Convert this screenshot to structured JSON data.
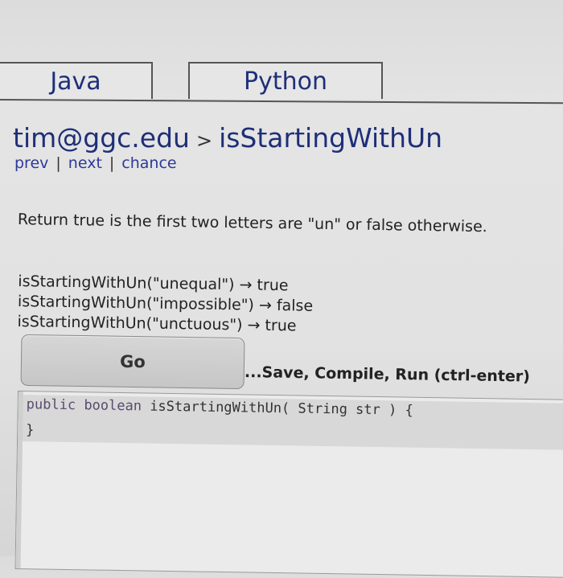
{
  "tabs": [
    {
      "label": "Java"
    },
    {
      "label": "Python"
    }
  ],
  "header": {
    "user": "tim@ggc.edu",
    "separator": ">",
    "problem": "isStartingWithUn"
  },
  "nav": {
    "prev": "prev",
    "next": "next",
    "chance": "chance",
    "divider": "|"
  },
  "description": "Return true is the first two letters are \"un\" or false otherwise.",
  "examples": [
    "isStartingWithUn(\"unequal\") → true",
    "isStartingWithUn(\"impossible\") → false",
    "isStartingWithUn(\"unctuous\") → true"
  ],
  "go_button": {
    "label": "Go",
    "hint": "...Save, Compile, Run (ctrl-enter)"
  },
  "editor": {
    "kw1": "public",
    "kw2": "boolean",
    "signature_rest": " isStartingWithUn( String str ) {",
    "line2": "}"
  }
}
